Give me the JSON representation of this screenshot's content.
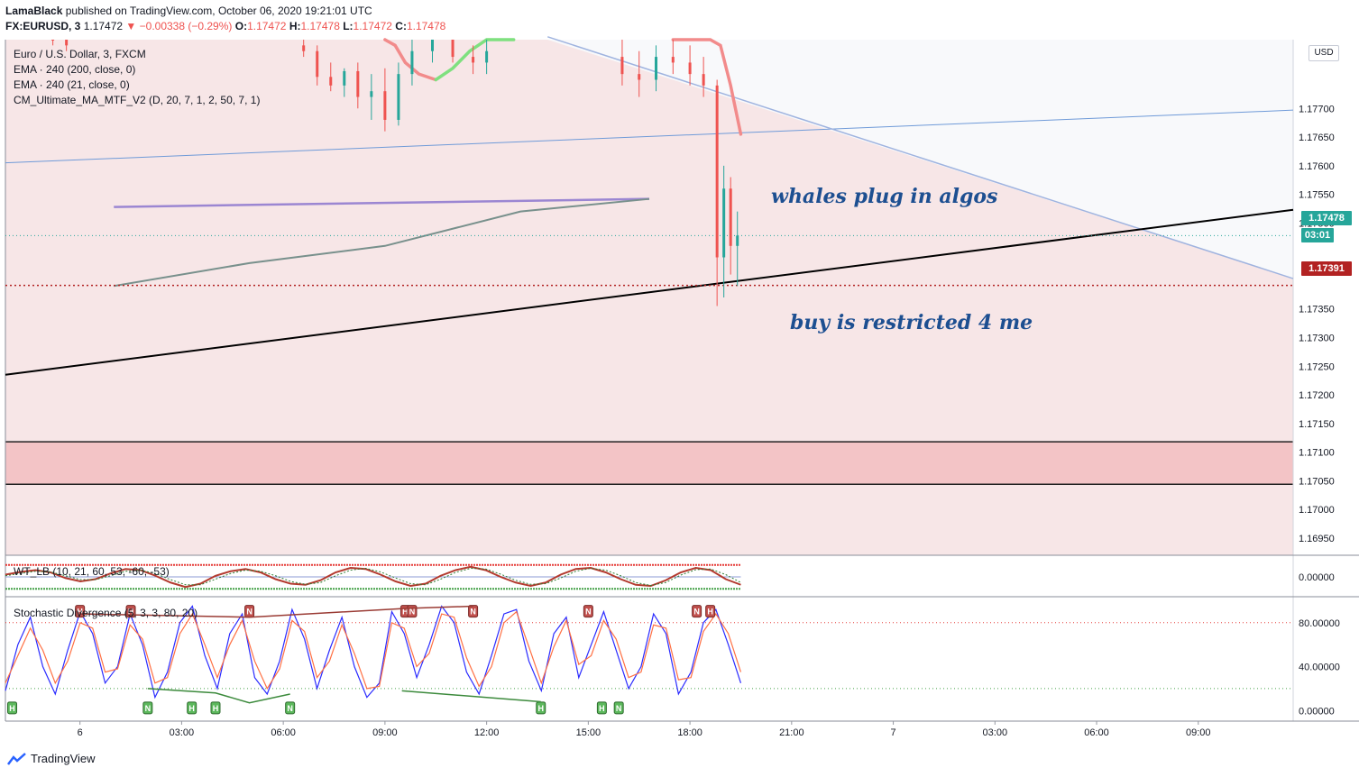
{
  "header": {
    "author": "LamaBlack",
    "published_text": "published on TradingView.com, October 06, 2020 19:21:01 UTC",
    "symbol": "FX:EURUSD, 3",
    "last": "1.17472",
    "change": "▼ −0.00338 (−0.29%)",
    "o_label": "O:",
    "o": "1.17472",
    "h_label": "H:",
    "h": "1.17478",
    "l_label": "L:",
    "l": "1.17472",
    "c_label": "C:",
    "c": "1.17478"
  },
  "indicators": {
    "title": "Euro / U.S. Dollar, 3, FXCM",
    "ema200": "EMA · 240 (200, close, 0)",
    "ema21": "EMA · 240 (21, close, 0)",
    "cm": "CM_Ultimate_MA_MTF_V2 (D, 20, 7, 1, 2, 50, 7, 1)",
    "wt": "WT_LB (10, 21, 60, 53, -60, -53)",
    "stoch": "Stochastic Divergence (5, 3, 3, 80, 20)"
  },
  "annotations": {
    "whales": "whales plug in algos",
    "buy": "buy is restricted 4 me"
  },
  "price_tags": {
    "current": "1.17478",
    "countdown": "03:01",
    "red_line": "1.17391"
  },
  "currency": "USD",
  "branding": "TradingView",
  "colors": {
    "up": "#26a69a",
    "down": "#ef5350",
    "redline": "#b22222",
    "countdown_bg": "#26a69a",
    "stoch_k": "#2b2bff",
    "stoch_d": "#ff7043"
  },
  "chart_data": [
    {
      "type": "candlestick",
      "title": "Euro / U.S. Dollar, 3, FXCM",
      "y_ticks": [
        "1.17700",
        "1.17650",
        "1.17600",
        "1.17550",
        "1.17500",
        "1.17250",
        "1.17300",
        "1.17350",
        "1.17200",
        "1.17150",
        "1.17100",
        "1.17050",
        "1.17000",
        "1.16950"
      ],
      "y_tick_values": [
        1.177,
        1.1765,
        1.176,
        1.1755,
        1.175,
        1.1725,
        1.173,
        1.1735,
        1.172,
        1.1715,
        1.171,
        1.1705,
        1.17,
        1.1695
      ],
      "ylim": [
        1.1692,
        1.1782
      ],
      "x_ticks": [
        "6",
        "03:00",
        "06:00",
        "09:00",
        "12:00",
        "15:00",
        "18:00",
        "21:00",
        "7",
        "03:00",
        "06:00",
        "09:00"
      ],
      "x_tick_hours": [
        0,
        3,
        6,
        9,
        12,
        15,
        18,
        21,
        24,
        27,
        30,
        33
      ],
      "xlim_hours": [
        -2.2,
        35.8
      ],
      "last_price": 1.17478,
      "red_line_level": 1.17391,
      "shaded_zone": [
        1.17044,
        1.17118
      ],
      "rising_support": {
        "from": [
          -2.2,
          1.17235
        ],
        "to": [
          35.8,
          1.17523
        ]
      },
      "blue_trendline": {
        "from": [
          -2.2,
          1.17605
        ],
        "to": [
          35.8,
          1.17697
        ]
      },
      "falling_trendline": {
        "from": [
          13.8,
          1.17825
        ],
        "to": [
          35.8,
          1.17403
        ]
      },
      "purple_line": {
        "from": [
          1.0,
          1.17528
        ],
        "to": [
          16.8,
          1.17542
        ]
      },
      "grey_line": [
        [
          1.0,
          1.1739
        ],
        [
          5.0,
          1.1743
        ],
        [
          9.0,
          1.1746
        ],
        [
          13.0,
          1.1752
        ],
        [
          16.8,
          1.17542
        ]
      ],
      "candles": [
        [
          -0.8,
          1.17845,
          1.17855,
          1.1781,
          1.1783
        ],
        [
          -0.4,
          1.1783,
          1.1784,
          1.178,
          1.1781
        ],
        [
          6.6,
          1.1781,
          1.17825,
          1.1779,
          1.178
        ],
        [
          7.0,
          1.178,
          1.1781,
          1.1774,
          1.17755
        ],
        [
          7.4,
          1.17755,
          1.1778,
          1.1773,
          1.1774
        ],
        [
          7.8,
          1.1774,
          1.1777,
          1.1772,
          1.17765
        ],
        [
          8.2,
          1.17765,
          1.1778,
          1.177,
          1.1772
        ],
        [
          8.6,
          1.1772,
          1.1776,
          1.1768,
          1.1773
        ],
        [
          9.0,
          1.1773,
          1.1777,
          1.1766,
          1.1768
        ],
        [
          9.4,
          1.1768,
          1.1778,
          1.1767,
          1.1776
        ],
        [
          9.8,
          1.1776,
          1.1782,
          1.1774,
          1.178
        ],
        [
          10.4,
          1.178,
          1.1784,
          1.1778,
          1.1782
        ],
        [
          11.0,
          1.1782,
          1.1784,
          1.1778,
          1.1779
        ],
        [
          11.6,
          1.1779,
          1.1781,
          1.1776,
          1.1778
        ],
        [
          12.0,
          1.1778,
          1.1782,
          1.1776,
          1.178
        ],
        [
          16.0,
          1.1779,
          1.1783,
          1.1774,
          1.1776
        ],
        [
          16.5,
          1.1776,
          1.178,
          1.1772,
          1.1775
        ],
        [
          17.0,
          1.1775,
          1.1781,
          1.1773,
          1.1779
        ],
        [
          17.5,
          1.1779,
          1.1783,
          1.1776,
          1.1778
        ],
        [
          18.0,
          1.1778,
          1.1781,
          1.1774,
          1.1776
        ],
        [
          18.4,
          1.1776,
          1.1779,
          1.1772,
          1.1774
        ],
        [
          18.8,
          1.1774,
          1.1775,
          1.17355,
          1.1744
        ],
        [
          19.0,
          1.1744,
          1.176,
          1.1737,
          1.1756
        ],
        [
          19.2,
          1.1756,
          1.1758,
          1.1741,
          1.1746
        ],
        [
          19.4,
          1.1746,
          1.1752,
          1.1739,
          1.17478
        ]
      ],
      "ema_red": [
        [
          9.0,
          1.17855
        ],
        [
          9.3,
          1.1781
        ],
        [
          9.6,
          1.1778
        ],
        [
          10.0,
          1.1776
        ],
        [
          10.5,
          1.1775
        ]
      ],
      "ema_green": [
        [
          10.5,
          1.1775
        ],
        [
          11.0,
          1.1777
        ],
        [
          11.5,
          1.178
        ],
        [
          12.0,
          1.1782
        ],
        [
          12.8,
          1.1784
        ]
      ],
      "ema_red2": [
        [
          17.5,
          1.1785
        ],
        [
          18.6,
          1.1785
        ],
        [
          18.9,
          1.1781
        ],
        [
          19.2,
          1.1774
        ],
        [
          19.5,
          1.17655
        ]
      ]
    },
    {
      "type": "line",
      "title": "WT_LB (10, 21, 60, 53, -60, -53)",
      "y_ticks": [
        "0.00000"
      ],
      "ylim": [
        -80,
        80
      ],
      "upper_band": 53,
      "lower_band": -53,
      "x_range_hours": [
        -2.2,
        19.5
      ],
      "series": [
        {
          "values": [
            10,
            22,
            30,
            20,
            -5,
            -20,
            -10,
            15,
            35,
            30,
            5,
            -25,
            -45,
            -30,
            5,
            25,
            35,
            20,
            -10,
            -30,
            -35,
            -15,
            20,
            40,
            35,
            10,
            -20,
            -40,
            -30,
            5,
            30,
            45,
            30,
            0,
            -25,
            -40,
            -25,
            10,
            35,
            40,
            20,
            -10,
            -35,
            -40,
            -15,
            20,
            40,
            30,
            -10,
            -35
          ]
        },
        {
          "values": [
            5,
            15,
            25,
            22,
            5,
            -12,
            -12,
            5,
            25,
            30,
            15,
            -12,
            -35,
            -35,
            -10,
            15,
            30,
            25,
            5,
            -20,
            -33,
            -25,
            5,
            30,
            38,
            22,
            -5,
            -30,
            -35,
            -10,
            20,
            38,
            35,
            12,
            -15,
            -33,
            -30,
            -5,
            25,
            38,
            30,
            5,
            -25,
            -38,
            -25,
            8,
            32,
            35,
            10,
            -25
          ]
        }
      ]
    },
    {
      "type": "line",
      "title": "Stochastic Divergence (5, 3, 3, 80, 20)",
      "y_ticks": [
        "80.00000",
        "40.00000",
        "0.00000"
      ],
      "ylim": [
        -8,
        102
      ],
      "levels": [
        80,
        20
      ],
      "x_range_hours": [
        -2.2,
        19.5
      ],
      "series": [
        {
          "values": [
            18,
            60,
            85,
            40,
            15,
            55,
            90,
            70,
            25,
            40,
            88,
            60,
            12,
            35,
            80,
            95,
            50,
            20,
            70,
            88,
            30,
            15,
            45,
            92,
            65,
            20,
            55,
            85,
            40,
            12,
            25,
            90,
            70,
            30,
            60,
            95,
            80,
            35,
            15,
            50,
            88,
            92,
            45,
            18,
            70,
            85,
            30,
            60,
            90,
            55,
            20,
            40,
            88,
            70,
            15,
            35,
            80,
            92,
            60,
            25
          ]
        },
        {
          "values": [
            25,
            50,
            75,
            55,
            25,
            45,
            80,
            75,
            35,
            38,
            78,
            65,
            25,
            30,
            70,
            88,
            60,
            30,
            60,
            82,
            45,
            20,
            38,
            82,
            72,
            30,
            45,
            78,
            52,
            20,
            22,
            80,
            75,
            40,
            52,
            88,
            85,
            48,
            22,
            40,
            80,
            90,
            58,
            25,
            58,
            82,
            42,
            50,
            82,
            65,
            30,
            35,
            78,
            75,
            28,
            30,
            72,
            88,
            70,
            35
          ]
        }
      ],
      "divergence_markers": {
        "upper": [
          "H",
          "H",
          "N",
          "H",
          "N",
          "N",
          "N",
          "H",
          "N"
        ],
        "lower": [
          "H",
          "N",
          "H",
          "H",
          "N",
          "H",
          "H",
          "N"
        ]
      }
    }
  ]
}
